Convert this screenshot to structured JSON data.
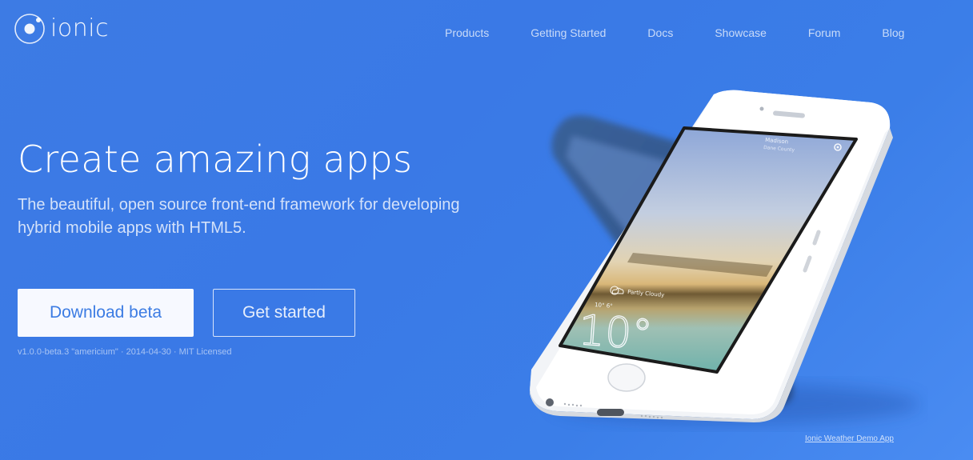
{
  "brand": {
    "name": "ionic",
    "icon": "ionic-logo-icon"
  },
  "nav": {
    "items": [
      {
        "label": "Products"
      },
      {
        "label": "Getting Started"
      },
      {
        "label": "Docs"
      },
      {
        "label": "Showcase"
      },
      {
        "label": "Forum"
      },
      {
        "label": "Blog"
      }
    ]
  },
  "hero": {
    "title": "Create amazing apps",
    "subtitle": "The beautiful, open source front-end framework for developing hybrid mobile apps with HTML5."
  },
  "buttons": {
    "download_label": "Download beta",
    "get_started_label": "Get started"
  },
  "version_info": "v1.0.0-beta.3 \"americium\" · 2014-04-30 · MIT Licensed",
  "phone": {
    "location_line1": "Madison",
    "location_line2": "Dane County",
    "condition": "Partly Cloudy",
    "high_low": "10° 6°",
    "temperature": "10°"
  },
  "demo_link": "Ionic Weather Demo App",
  "colors": {
    "background": "#3b7ae6",
    "button_text": "#3c7ce3",
    "button_bg": "#f7f9ff"
  }
}
